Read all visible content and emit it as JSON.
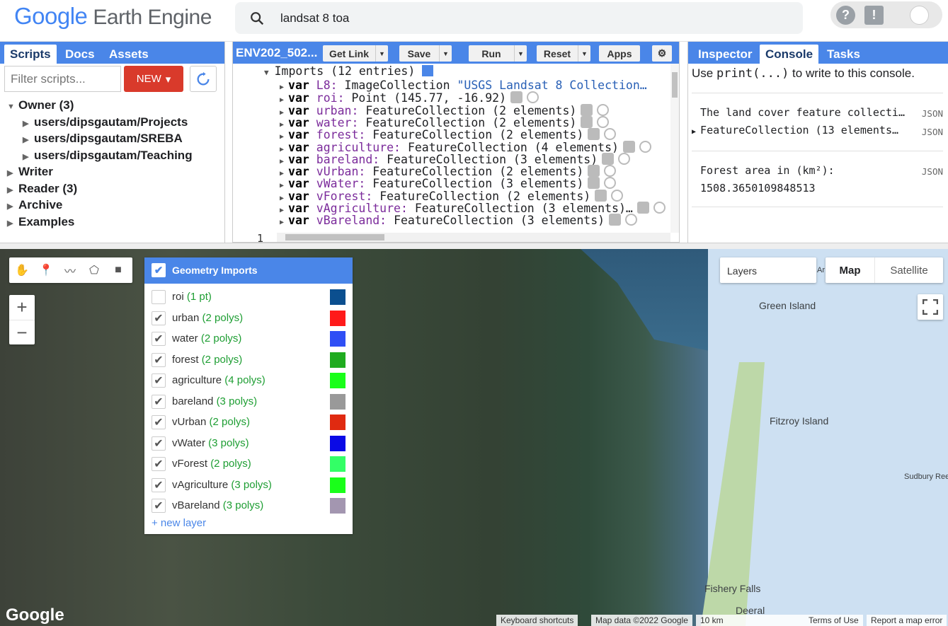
{
  "app": {
    "logo_google": "Google",
    "logo_product": "Earth Engine"
  },
  "search": {
    "query": "landsat 8 toa"
  },
  "left_panel": {
    "tabs": [
      "Scripts",
      "Docs",
      "Assets"
    ],
    "filter_placeholder": "Filter scripts...",
    "new_button": "NEW",
    "tree": {
      "owner": "Owner (3)",
      "owner_children": [
        "users/dipsgautam/Projects",
        "users/dipsgautam/SREBA",
        "users/dipsgautam/Teaching"
      ],
      "others": [
        "Writer",
        "Reader (3)",
        "Archive",
        "Examples"
      ]
    }
  },
  "editor": {
    "title": "ENV202_502...",
    "buttons": {
      "get_link": "Get Link",
      "save": "Save",
      "run": "Run",
      "reset": "Reset",
      "apps": "Apps"
    },
    "imports_header": "Imports (12 entries)",
    "imports": [
      {
        "name": "L8:",
        "type": "ImageCollection",
        "value": "\"USGS Landsat 8 Collection…"
      },
      {
        "name": "roi:",
        "type": "Point (145.77, -16.92)",
        "value": ""
      },
      {
        "name": "urban:",
        "type": "FeatureCollection (2 elements)",
        "value": ""
      },
      {
        "name": "water:",
        "type": "FeatureCollection (2 elements)",
        "value": ""
      },
      {
        "name": "forest:",
        "type": "FeatureCollection (2 elements)",
        "value": ""
      },
      {
        "name": "agriculture:",
        "type": "FeatureCollection (4 elements)",
        "value": ""
      },
      {
        "name": "bareland:",
        "type": "FeatureCollection (3 elements)",
        "value": ""
      },
      {
        "name": "vUrban:",
        "type": "FeatureCollection (2 elements)",
        "value": ""
      },
      {
        "name": "vWater:",
        "type": "FeatureCollection (3 elements)",
        "value": ""
      },
      {
        "name": "vForest:",
        "type": "FeatureCollection (2 elements)",
        "value": ""
      },
      {
        "name": "vAgriculture:",
        "type": "FeatureCollection (3 elements)…",
        "value": ""
      },
      {
        "name": "vBareland:",
        "type": "FeatureCollection (3 elements)",
        "value": ""
      }
    ],
    "line_number": "1"
  },
  "right_panel": {
    "tabs": [
      "Inspector",
      "Console",
      "Tasks"
    ],
    "hint_prefix": "Use ",
    "hint_code": "print(...)",
    "hint_suffix": " to write to this console.",
    "entries": [
      {
        "line1": "The land cover feature collecti…",
        "line2": "FeatureCollection (13 elements…",
        "tag": "JSON"
      },
      {
        "line1": "Forest area in (km²):",
        "line2": "1508.3650109848513",
        "tag": "JSON"
      }
    ]
  },
  "map": {
    "geometry_title": "Geometry Imports",
    "layers": [
      {
        "name": "roi",
        "count": "(1 pt)",
        "checked": false,
        "color": "#0b4f8f"
      },
      {
        "name": "urban",
        "count": "(2 polys)",
        "checked": true,
        "color": "#ff1a1a"
      },
      {
        "name": "water",
        "count": "(2 polys)",
        "checked": true,
        "color": "#2f4ff5"
      },
      {
        "name": "forest",
        "count": "(2 polys)",
        "checked": true,
        "color": "#1fab1f"
      },
      {
        "name": "agriculture",
        "count": "(4 polys)",
        "checked": true,
        "color": "#1aff1a"
      },
      {
        "name": "bareland",
        "count": "(3 polys)",
        "checked": true,
        "color": "#999999"
      },
      {
        "name": "vUrban",
        "count": "(2 polys)",
        "checked": true,
        "color": "#e02a10"
      },
      {
        "name": "vWater",
        "count": "(3 polys)",
        "checked": true,
        "color": "#0a0ae6"
      },
      {
        "name": "vForest",
        "count": "(2 polys)",
        "checked": true,
        "color": "#33ff66"
      },
      {
        "name": "vAgriculture",
        "count": "(3 polys)",
        "checked": true,
        "color": "#1aff1a"
      },
      {
        "name": "vBareland",
        "count": "(3 polys)",
        "checked": true,
        "color": "#a396b0"
      }
    ],
    "new_layer": "+ new layer",
    "layers_label": "Layers",
    "layers_overflow": "Ar",
    "map_type": {
      "map": "Map",
      "satellite": "Satellite"
    },
    "places": [
      "Green Island",
      "Fitzroy Island",
      "Sudbury Ree",
      "Fishery Falls",
      "Deeral"
    ],
    "google_logo": "Google",
    "footer": {
      "shortcuts": "Keyboard shortcuts",
      "mapdata": "Map data ©2022 Google",
      "scale": "10 km",
      "terms": "Terms of Use",
      "report": "Report a map error"
    }
  }
}
